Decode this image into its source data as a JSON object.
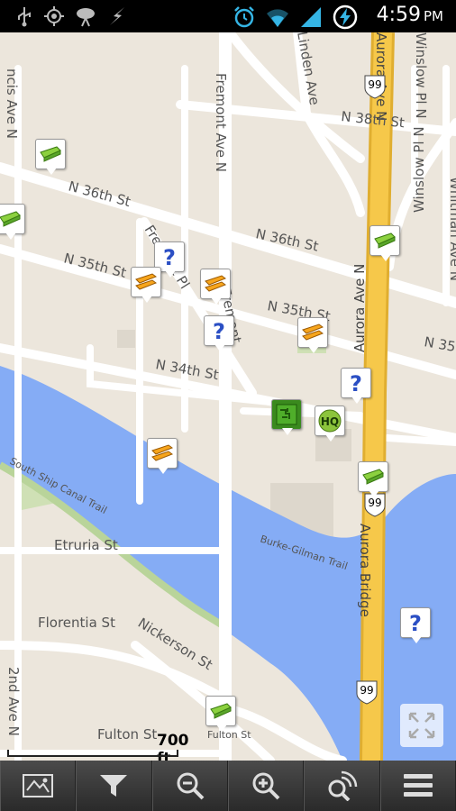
{
  "status_bar": {
    "time": "4:59",
    "ampm": "PM",
    "left_icons": [
      "usb-icon",
      "gps-icon",
      "satellite-dish-icon",
      "signal-bolt-icon"
    ],
    "right_icons": [
      "alarm-clock-icon",
      "wifi-icon",
      "cell-signal-icon",
      "battery-charging-icon"
    ]
  },
  "map": {
    "street_labels": [
      "ncis Ave N",
      "Fremont Ave N",
      "Linden Ave",
      "Aurora Ave N",
      "Winslow Pl N",
      "N 38th St",
      "N 36th St",
      "N 36th St",
      "Fremont Pl",
      "N 35th St",
      "N 35th St",
      "Fremont",
      "N 35",
      "N 34th St",
      "Aurora Ave N",
      "Whitman Ave N",
      "Winslow Pl N",
      "South Ship Canal Trail",
      "Etruria St",
      "Burke-Gilman Trail",
      "Aurora Bridge",
      "Florentia St",
      "Nickerson St",
      "2nd Ave N",
      "Fulton St",
      "Fulton St"
    ],
    "highway_shields": [
      "99",
      "99",
      "99"
    ],
    "markers": [
      {
        "type": "traditional-cache-icon"
      },
      {
        "type": "traditional-cache-icon"
      },
      {
        "type": "mystery-cache-icon"
      },
      {
        "type": "multi-cache-icon"
      },
      {
        "type": "multi-cache-icon"
      },
      {
        "type": "mystery-cache-icon"
      },
      {
        "type": "multi-cache-icon"
      },
      {
        "type": "traditional-cache-icon"
      },
      {
        "type": "mystery-cache-icon"
      },
      {
        "type": "earthcache-icon"
      },
      {
        "type": "headquarters-icon",
        "label": "HQ"
      },
      {
        "type": "multi-cache-icon"
      },
      {
        "type": "traditional-cache-icon"
      },
      {
        "type": "mystery-cache-icon"
      },
      {
        "type": "traditional-cache-icon"
      }
    ],
    "scale": {
      "label": "700 ft"
    }
  },
  "toolbar": {
    "buttons": [
      "map-layers-icon",
      "filter-icon",
      "zoom-out-icon",
      "zoom-in-icon",
      "search-nearby-icon",
      "menu-icon"
    ]
  },
  "colors": {
    "land": "#ece6dc",
    "water": "#85acf5",
    "park": "#cfe0b5",
    "highway": "#f6c84a",
    "road": "#ffffff"
  }
}
